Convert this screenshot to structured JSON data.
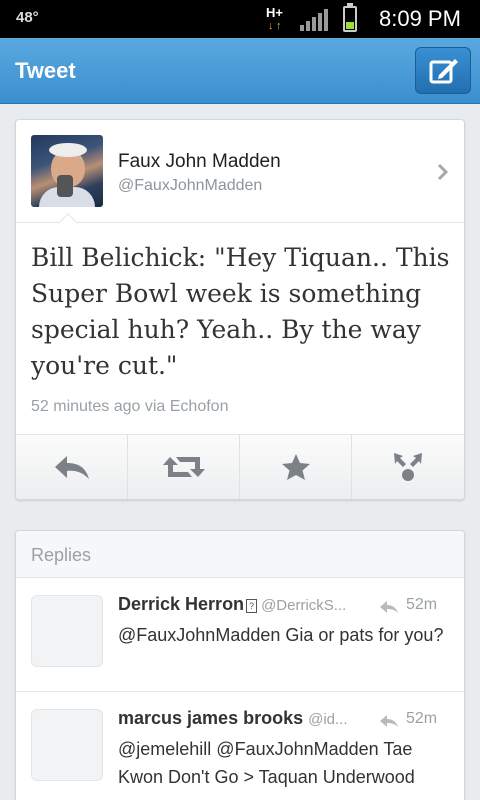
{
  "status_bar": {
    "temperature": "48°",
    "network": "H+",
    "time": "8:09 PM"
  },
  "action_bar": {
    "title": "Tweet",
    "compose_icon": "compose-icon"
  },
  "tweet": {
    "author_name": "Faux John Madden",
    "author_handle": "@FauxJohnMadden",
    "text": "Bill Belichick: \"Hey Tiquan.. This Super Bowl week is something special huh? Yeah.. By the way you're cut.\"",
    "meta": "52 minutes ago via Echofon",
    "actions": [
      "reply-icon",
      "retweet-icon",
      "favorite-icon",
      "share-icon"
    ]
  },
  "replies": {
    "title": "Replies",
    "items": [
      {
        "name": "Derrick Herron",
        "badge": "?",
        "handle": "@DerrickS...",
        "time": "52m",
        "text": "@FauxJohnMadden Gia or pats for you?"
      },
      {
        "name": "marcus james brooks",
        "handle": "@id...",
        "time": "52m",
        "text": "@jemelehill @FauxJohnMadden Tae Kwon Don't Go > Taquan Underwood"
      }
    ]
  },
  "colors": {
    "action_bar": "#3b8fd0",
    "background": "#e9ecee",
    "battery": "#9be03a"
  }
}
